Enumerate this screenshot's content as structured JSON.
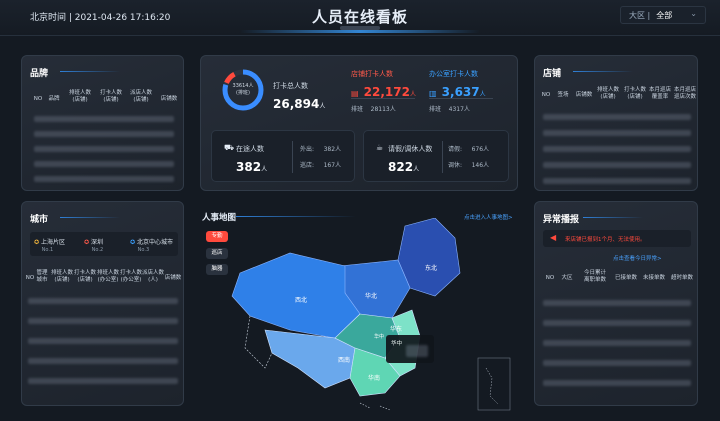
{
  "header": {
    "clock": "北京时间 | 2021-04-26 17:16:20",
    "title": "人员在线看板",
    "region_label": "大区 |",
    "region_value": "全部"
  },
  "brand": {
    "title": "品牌",
    "columns": [
      "NO",
      "品牌",
      "排班人数\n(店铺)",
      "打卡人数\n(店铺)",
      "派店人数\n(店铺)",
      "店铺数"
    ]
  },
  "summary": {
    "ring_text": "33614人\n(排班)",
    "punch_label": "打卡总人数",
    "punch_value": "26,894",
    "unit": "人",
    "store_label": "店铺打卡人数",
    "store_value": "22,172",
    "store_sched_label": "排班",
    "store_sched_value": "28113人",
    "office_label": "办公室打卡人数",
    "office_value": "3,637",
    "office_sched_label": "排班",
    "office_sched_value": "4317人",
    "onsite_label": "在途人数",
    "onsite_value": "382",
    "out_label": "外出:",
    "out_value": "382人",
    "visit_label": "巡店:",
    "visit_value": "167人",
    "leave_label": "请假/调休人数",
    "leave_value": "822",
    "leave_a_label": "请假:",
    "leave_a_value": "676人",
    "leave_b_label": "调休:",
    "leave_b_value": "146人"
  },
  "store": {
    "title": "店铺",
    "columns": [
      "NO",
      "签场",
      "店铺数",
      "排班人数\n(店铺)",
      "打卡人数\n(店铺)",
      "本月巡店\n覆盖率",
      "本月巡店\n巡店次数"
    ]
  },
  "city": {
    "title": "城市",
    "ranks": [
      {
        "name": "上海片区",
        "no": "No.1"
      },
      {
        "name": "深圳",
        "no": "No.2"
      },
      {
        "name": "北京中心城市",
        "no": "No.3"
      }
    ],
    "columns": [
      "NO",
      "管理\n城市",
      "排班人数\n(店铺)",
      "打卡人数\n(店铺)",
      "排班人数\n(办公室)",
      "打卡人数\n(办公室)",
      "派店人数\n(人)",
      "店铺数"
    ]
  },
  "map": {
    "title": "人事地图",
    "link": "点击进入人事地图>",
    "buttons": [
      "专勤",
      "巡店",
      "脑器"
    ],
    "labels": [
      "东北",
      "华北",
      "西北",
      "西南",
      "华南",
      "华东",
      "华中"
    ],
    "popup": "华中"
  },
  "alert": {
    "title": "异常播报",
    "message": "来店铺已报到1个月、无法使用。",
    "link": "点击查看今日异常>",
    "columns": [
      "NO",
      "大区",
      "今日累计\n离职单数",
      "已接单数",
      "未接单数",
      "超时单数"
    ]
  },
  "colors": {
    "accent": "#3aa0ff",
    "red": "#ff4a3d",
    "panel": "#222932"
  }
}
